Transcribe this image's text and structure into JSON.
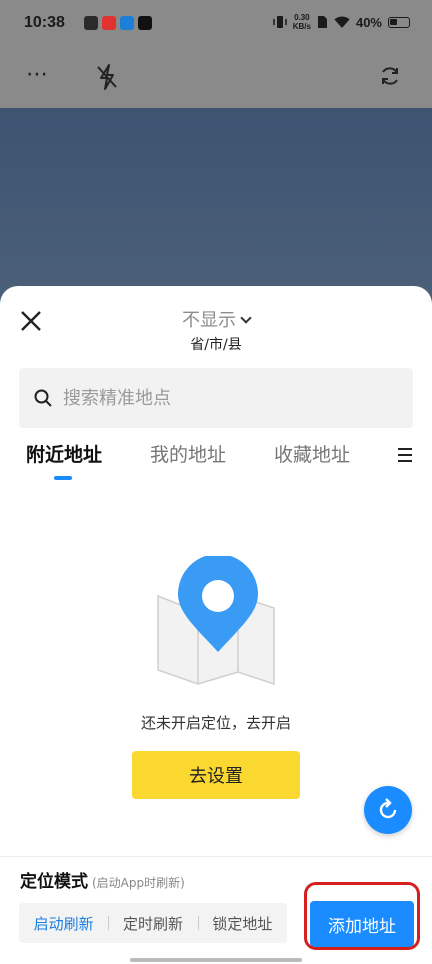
{
  "status_bar": {
    "time": "10:38",
    "net_speed_value": "0.30",
    "net_speed_unit": "KB/s",
    "battery": "40%"
  },
  "top_bar": {
    "more_icon": "more-icon",
    "flash_icon": "flash-off-icon",
    "refresh_icon": "rotate-icon"
  },
  "sheet": {
    "title": "不显示",
    "subtitle": "省/市/县",
    "search": {
      "placeholder": "搜索精准地点",
      "value": ""
    },
    "tabs": [
      {
        "label": "附近地址",
        "active": true
      },
      {
        "label": "我的地址",
        "active": false
      },
      {
        "label": "收藏地址",
        "active": false
      }
    ],
    "empty_message": "还未开启定位，去开启",
    "go_settings_label": "去设置"
  },
  "location_mode": {
    "title": "定位模式",
    "hint": "(启动App时刷新)",
    "options": [
      {
        "label": "启动刷新",
        "active": true
      },
      {
        "label": "定时刷新",
        "active": false
      },
      {
        "label": "锁定地址",
        "active": false
      }
    ],
    "add_address_label": "添加地址"
  },
  "colors": {
    "accent": "#1a8cff",
    "button_yellow": "#fbd82f",
    "highlight_ring": "#d62020"
  }
}
